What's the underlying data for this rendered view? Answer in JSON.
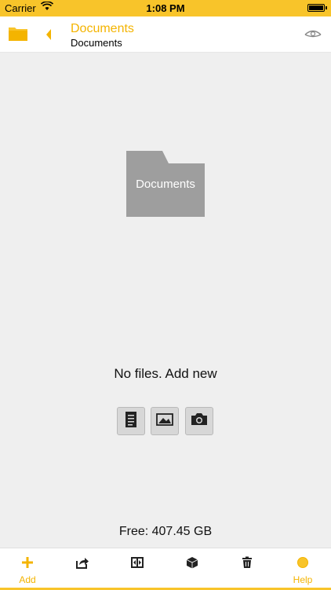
{
  "status_bar": {
    "carrier": "Carrier",
    "time": "1:08 PM"
  },
  "nav": {
    "title": "Documents",
    "subtitle": "Documents",
    "icons": [
      "folder-icon",
      "back-arrow-icon",
      "eye-icon"
    ]
  },
  "main": {
    "folder_label": "Documents",
    "empty_message": "No files. Add new",
    "add_buttons": [
      "document-icon",
      "image-icon",
      "camera-icon"
    ],
    "free_space": "Free: 407.45 GB"
  },
  "toolbar": {
    "add_label": "Add",
    "help_label": "Help",
    "icons": [
      "plus-icon",
      "share-icon",
      "move-icon",
      "box-icon",
      "trash-icon",
      "help-icon"
    ]
  },
  "colors": {
    "accent": "#f8c42a",
    "accent_text": "#f4b400",
    "folder_grey": "#9e9e9e",
    "background": "#efefef"
  }
}
